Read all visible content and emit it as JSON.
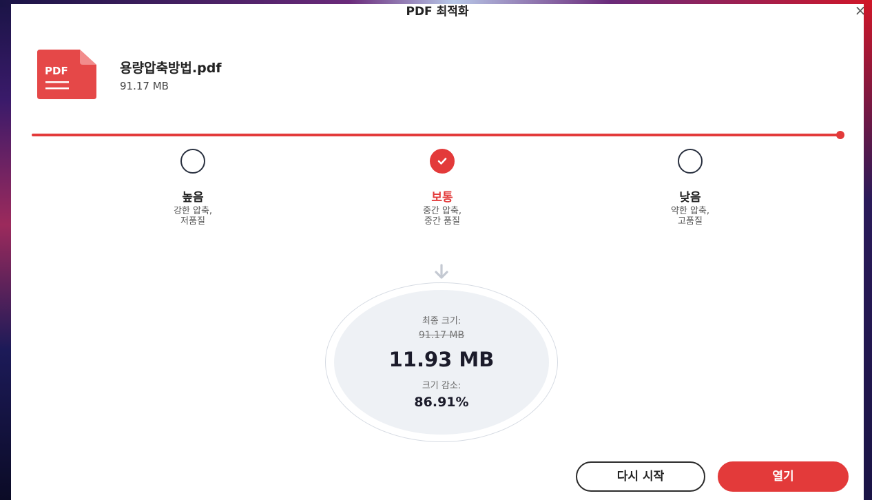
{
  "dialog": {
    "title": "PDF 최적화",
    "close_symbol": "×"
  },
  "file": {
    "icon_label": "PDF",
    "name": "용량압축방법.pdf",
    "size": "91.17 MB"
  },
  "slider": {
    "level": 1.0
  },
  "options": [
    {
      "name": "높음",
      "desc_line1": "강한 압축,",
      "desc_line2": "저품질",
      "selected": false
    },
    {
      "name": "보통",
      "desc_line1": "중간 압축,",
      "desc_line2": "중간 품질",
      "selected": true
    },
    {
      "name": "낮음",
      "desc_line1": "약한 압축,",
      "desc_line2": "고품질",
      "selected": false
    }
  ],
  "result": {
    "final_size_label": "최종 크기:",
    "original_size": "91.17 MB",
    "final_size": "11.93 MB",
    "reduction_label": "크기 감소:",
    "reduction": "86.91%"
  },
  "buttons": {
    "restart": "다시 시작",
    "open": "열기"
  },
  "colors": {
    "accent": "#e33a3a",
    "text_dark": "#222222",
    "result_bg": "#eef1f5"
  }
}
